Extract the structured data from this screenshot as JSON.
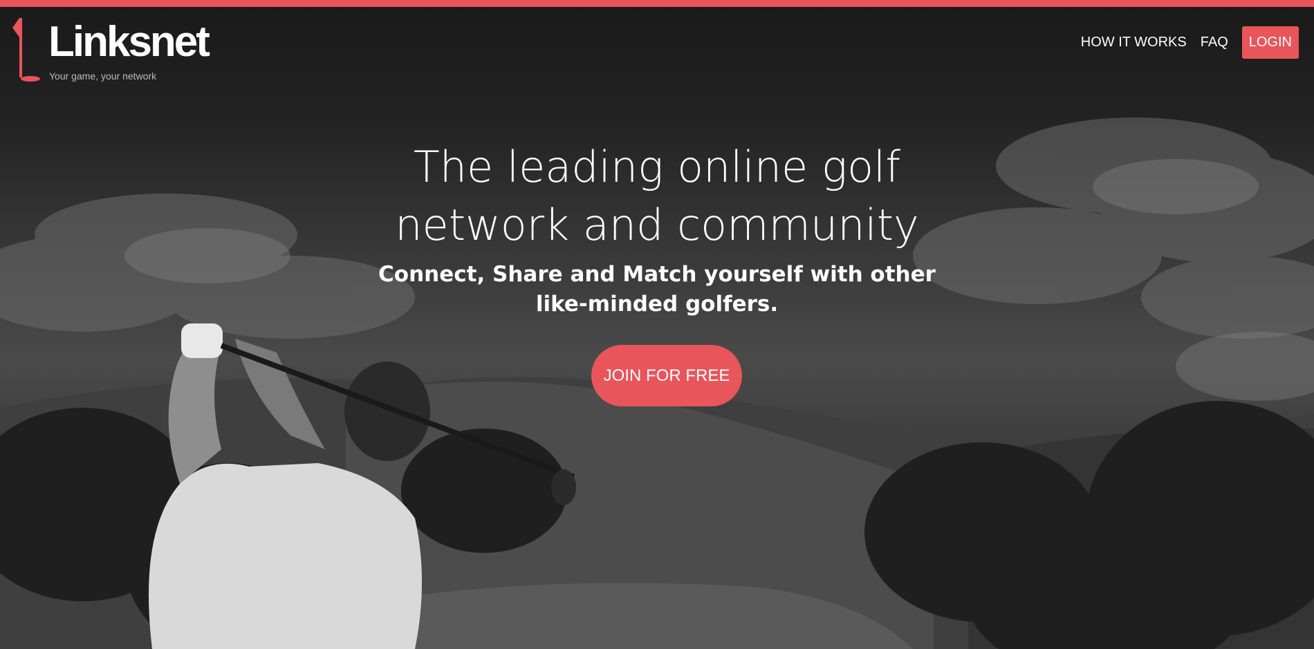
{
  "brand": {
    "name": "Linksnet",
    "tagline": "Your game, your network",
    "logo_icon": "golf-flag-icon"
  },
  "nav": {
    "items": [
      {
        "label": "HOW IT WORKS"
      },
      {
        "label": "FAQ"
      }
    ],
    "login_label": "LOGIN"
  },
  "hero": {
    "title_line1": "The leading online golf",
    "title_line2": "network and community",
    "subtitle": "Connect, Share and Match yourself with other like-minded golfers.",
    "cta_label": "JOIN FOR FREE",
    "background": "black-and-white photo of a golfer mid-swing with hills and trees"
  },
  "colors": {
    "accent": "#e8555a",
    "header_bg": "#1b1b1b",
    "text": "#ffffff"
  }
}
